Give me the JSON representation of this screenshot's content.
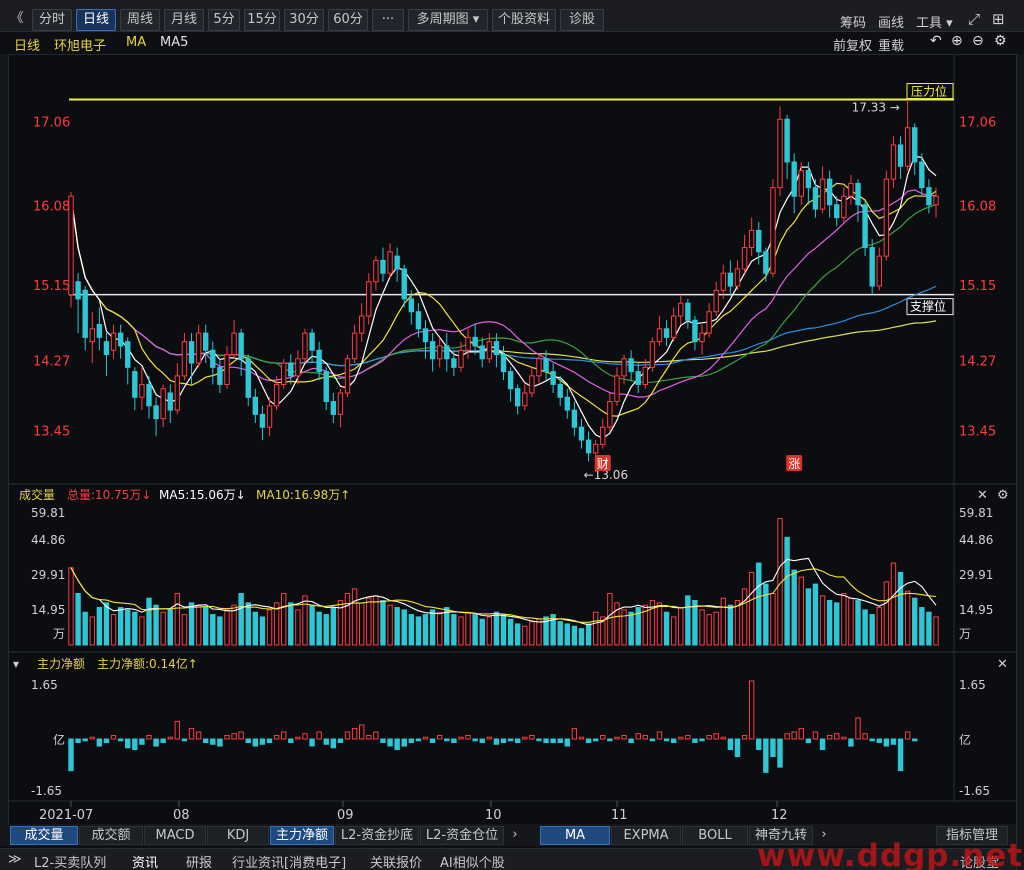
{
  "toolbar": {
    "items": [
      "《",
      "分时",
      "日线",
      "周线",
      "月线",
      "5分",
      "15分",
      "30分",
      "60分",
      "···",
      "多周期图 ▾",
      "个股资料",
      "诊股"
    ],
    "active": "日线",
    "right_items": [
      "筹码",
      "画线",
      "工具 ▾"
    ]
  },
  "sub_toolbar": {
    "period": "日线",
    "stock": "环旭电子",
    "ma_label": "MA",
    "ma_extra": "MA5",
    "right_items": [
      "前复权",
      "重载"
    ]
  },
  "price_panel": {
    "y_ticks": [
      "17.06",
      "16.08",
      "15.15",
      "14.27",
      "13.45"
    ],
    "high_marker": "17.33",
    "low_marker": "←13.06",
    "pressure_label": "压力位",
    "support_label": "支撑位",
    "events": [
      "财",
      "涨"
    ]
  },
  "volume_panel": {
    "title": "成交量",
    "total": "总量:10.75万",
    "ma5": "MA5:15.06万",
    "ma10": "MA10:16.98万",
    "y_ticks": [
      "59.81",
      "44.86",
      "29.91",
      "14.95",
      "万"
    ]
  },
  "flow_panel": {
    "title": "主力净额",
    "value": "主力净额:0.14亿",
    "y_ticks": [
      "1.65",
      "亿",
      "-1.65"
    ]
  },
  "x_axis": [
    "2021-07",
    "08",
    "09",
    "10",
    "11",
    "12"
  ],
  "indicator_tabs": {
    "left": [
      "成交量",
      "成交额",
      "MACD",
      "KDJ",
      "主力净额",
      "L2-资金抄底",
      "L2-资金仓位"
    ],
    "active_left": [
      "成交量",
      "主力净额"
    ],
    "right": [
      "MA",
      "EXPMA",
      "BOLL",
      "神奇九转"
    ],
    "active_right": "MA",
    "manage": "指标管理"
  },
  "bottom_bar": {
    "items": [
      "L2-买卖队列",
      "资讯",
      "研报",
      "行业资讯[消费电子]",
      "关联报价",
      "AI相似个股"
    ],
    "active": "资讯",
    "watermark": "www.ddgp.net",
    "right_text": "论股堂"
  },
  "colors": {
    "up": "#ff3b3b",
    "down": "#2ec7d6",
    "ma5": "#ffffff",
    "ma10": "#f5e23a",
    "ma20": "#e65ee6",
    "ma30": "#3ca23c",
    "ma60": "#2f8fe0",
    "ma120": "#dede5a"
  },
  "chart_data": {
    "type": "candlestick",
    "title": "环旭电子 日线",
    "x_months": [
      "2021-07",
      "08",
      "09",
      "10",
      "11",
      "12"
    ],
    "price_ylim": [
      13.0,
      17.5
    ],
    "horizontal_lines": [
      {
        "label": "压力位",
        "value": 17.33
      },
      {
        "label": "支撑位",
        "value": 15.05
      }
    ],
    "high": 17.33,
    "low": 13.06,
    "candles": [
      [
        15.05,
        16.2,
        16.25,
        14.9
      ],
      [
        15.2,
        15.0,
        15.3,
        14.6
      ],
      [
        15.1,
        14.55,
        15.15,
        14.4
      ],
      [
        14.5,
        14.65,
        14.85,
        14.25
      ],
      [
        14.7,
        14.55,
        14.9,
        14.4
      ],
      [
        14.5,
        14.35,
        14.6,
        14.1
      ],
      [
        14.4,
        14.6,
        14.7,
        14.3
      ],
      [
        14.6,
        14.45,
        14.7,
        14.3
      ],
      [
        14.5,
        14.2,
        14.55,
        14.0
      ],
      [
        14.15,
        13.85,
        14.2,
        13.7
      ],
      [
        13.85,
        14.0,
        14.2,
        13.7
      ],
      [
        14.0,
        13.75,
        14.1,
        13.6
      ],
      [
        13.75,
        13.6,
        13.85,
        13.4
      ],
      [
        13.6,
        13.95,
        14.0,
        13.5
      ],
      [
        13.9,
        13.7,
        14.0,
        13.55
      ],
      [
        13.7,
        14.1,
        14.25,
        13.65
      ],
      [
        14.1,
        14.5,
        14.6,
        14.05
      ],
      [
        14.5,
        14.25,
        14.6,
        14.0
      ],
      [
        14.25,
        14.6,
        14.7,
        14.2
      ],
      [
        14.6,
        14.4,
        14.7,
        14.25
      ],
      [
        14.4,
        14.2,
        14.5,
        14.0
      ],
      [
        14.2,
        14.0,
        14.3,
        13.9
      ],
      [
        14.0,
        14.35,
        14.45,
        13.95
      ],
      [
        14.35,
        14.6,
        14.75,
        14.3
      ],
      [
        14.6,
        14.3,
        14.65,
        14.1
      ],
      [
        14.3,
        13.85,
        14.35,
        13.75
      ],
      [
        13.85,
        13.65,
        13.95,
        13.55
      ],
      [
        13.65,
        13.5,
        13.75,
        13.35
      ],
      [
        13.5,
        13.75,
        13.85,
        13.4
      ],
      [
        13.75,
        14.0,
        14.1,
        13.7
      ],
      [
        14.0,
        14.25,
        14.3,
        13.95
      ],
      [
        14.25,
        14.1,
        14.35,
        14.0
      ],
      [
        14.1,
        14.3,
        14.4,
        14.0
      ],
      [
        14.3,
        14.6,
        14.65,
        14.25
      ],
      [
        14.6,
        14.4,
        14.65,
        14.25
      ],
      [
        14.4,
        14.15,
        14.5,
        14.05
      ],
      [
        14.15,
        13.8,
        14.2,
        13.7
      ],
      [
        13.8,
        13.65,
        13.9,
        13.55
      ],
      [
        13.65,
        13.9,
        13.95,
        13.5
      ],
      [
        13.9,
        14.3,
        14.35,
        13.85
      ],
      [
        14.3,
        14.6,
        14.7,
        14.25
      ],
      [
        14.6,
        14.8,
        14.95,
        14.5
      ],
      [
        14.8,
        15.2,
        15.3,
        14.7
      ],
      [
        15.2,
        15.45,
        15.5,
        15.1
      ],
      [
        15.45,
        15.3,
        15.6,
        15.2
      ],
      [
        15.3,
        15.55,
        15.65,
        15.25
      ],
      [
        15.5,
        15.35,
        15.6,
        15.2
      ],
      [
        15.35,
        15.0,
        15.4,
        14.9
      ],
      [
        15.0,
        14.85,
        15.1,
        14.7
      ],
      [
        14.85,
        14.65,
        14.95,
        14.55
      ],
      [
        14.65,
        14.5,
        14.75,
        14.3
      ],
      [
        14.5,
        14.3,
        14.6,
        14.15
      ],
      [
        14.3,
        14.45,
        14.55,
        14.2
      ],
      [
        14.45,
        14.3,
        14.6,
        14.15
      ],
      [
        14.3,
        14.2,
        14.4,
        14.1
      ],
      [
        14.2,
        14.4,
        14.5,
        14.15
      ],
      [
        14.4,
        14.55,
        14.65,
        14.3
      ],
      [
        14.55,
        14.45,
        14.7,
        14.35
      ],
      [
        14.45,
        14.3,
        14.55,
        14.2
      ],
      [
        14.3,
        14.5,
        14.6,
        14.25
      ],
      [
        14.5,
        14.35,
        14.6,
        14.2
      ],
      [
        14.35,
        14.15,
        14.45,
        14.05
      ],
      [
        14.15,
        13.95,
        14.2,
        13.8
      ],
      [
        13.95,
        13.75,
        14.0,
        13.65
      ],
      [
        13.75,
        13.9,
        14.0,
        13.7
      ],
      [
        13.9,
        14.1,
        14.2,
        13.85
      ],
      [
        14.1,
        14.3,
        14.35,
        14.0
      ],
      [
        14.3,
        14.15,
        14.4,
        14.05
      ],
      [
        14.15,
        14.0,
        14.25,
        13.9
      ],
      [
        14.0,
        13.85,
        14.1,
        13.75
      ],
      [
        13.85,
        13.7,
        13.95,
        13.6
      ],
      [
        13.7,
        13.5,
        13.8,
        13.4
      ],
      [
        13.5,
        13.35,
        13.6,
        13.25
      ],
      [
        13.35,
        13.2,
        13.45,
        13.1
      ],
      [
        13.2,
        13.3,
        13.35,
        13.06
      ],
      [
        13.3,
        13.5,
        13.6,
        13.25
      ],
      [
        13.5,
        13.8,
        13.9,
        13.45
      ],
      [
        13.8,
        14.1,
        14.2,
        13.75
      ],
      [
        14.1,
        14.3,
        14.35,
        14.0
      ],
      [
        14.3,
        14.15,
        14.4,
        14.05
      ],
      [
        14.15,
        14.0,
        14.25,
        13.9
      ],
      [
        14.0,
        14.2,
        14.3,
        13.95
      ],
      [
        14.2,
        14.5,
        14.55,
        14.15
      ],
      [
        14.5,
        14.65,
        14.8,
        14.45
      ],
      [
        14.65,
        14.55,
        14.75,
        14.45
      ],
      [
        14.55,
        14.8,
        14.9,
        14.5
      ],
      [
        14.8,
        14.95,
        15.05,
        14.7
      ],
      [
        14.95,
        14.75,
        15.0,
        14.65
      ],
      [
        14.75,
        14.5,
        14.8,
        14.4
      ],
      [
        14.5,
        14.6,
        14.7,
        14.35
      ],
      [
        14.6,
        14.85,
        14.95,
        14.55
      ],
      [
        14.85,
        15.1,
        15.2,
        14.8
      ],
      [
        15.1,
        15.3,
        15.4,
        15.0
      ],
      [
        15.3,
        15.15,
        15.45,
        15.05
      ],
      [
        15.15,
        15.35,
        15.45,
        15.1
      ],
      [
        15.35,
        15.6,
        15.75,
        15.3
      ],
      [
        15.6,
        15.8,
        15.95,
        15.5
      ],
      [
        15.8,
        15.55,
        15.9,
        15.4
      ],
      [
        15.55,
        15.3,
        15.6,
        15.2
      ],
      [
        15.3,
        16.3,
        16.4,
        15.25
      ],
      [
        16.3,
        17.1,
        17.25,
        16.2
      ],
      [
        17.1,
        16.6,
        17.15,
        16.4
      ],
      [
        16.6,
        16.2,
        16.7,
        16.0
      ],
      [
        16.2,
        16.5,
        16.6,
        16.1
      ],
      [
        16.5,
        16.3,
        16.6,
        16.1
      ],
      [
        16.3,
        16.05,
        16.4,
        15.95
      ],
      [
        16.05,
        16.4,
        16.55,
        16.0
      ],
      [
        16.4,
        16.1,
        16.5,
        15.95
      ],
      [
        16.1,
        15.95,
        16.2,
        15.85
      ],
      [
        15.95,
        16.2,
        16.3,
        15.9
      ],
      [
        16.2,
        16.35,
        16.45,
        16.1
      ],
      [
        16.35,
        16.1,
        16.4,
        15.9
      ],
      [
        16.1,
        15.6,
        16.15,
        15.5
      ],
      [
        15.6,
        15.15,
        15.7,
        15.05
      ],
      [
        15.15,
        15.5,
        15.6,
        15.1
      ],
      [
        15.5,
        16.4,
        16.5,
        15.45
      ],
      [
        16.4,
        16.8,
        16.9,
        16.3
      ],
      [
        16.8,
        16.55,
        16.9,
        16.4
      ],
      [
        16.55,
        17.0,
        17.33,
        16.5
      ],
      [
        17.0,
        16.6,
        17.05,
        16.45
      ],
      [
        16.6,
        16.3,
        16.7,
        16.2
      ],
      [
        16.3,
        16.1,
        16.4,
        16.0
      ],
      [
        16.1,
        16.2,
        16.3,
        15.95
      ]
    ],
    "volume_ylim": [
      0,
      59.81
    ],
    "volumes": [
      33,
      22,
      14,
      12,
      16,
      18,
      13,
      16,
      15,
      14,
      12,
      20,
      17,
      14,
      15,
      22,
      13,
      18,
      17,
      16,
      13,
      12,
      15,
      17,
      22,
      18,
      14,
      12,
      15,
      18,
      22,
      18,
      15,
      21,
      17,
      14,
      13,
      16,
      19,
      22,
      24,
      18,
      20,
      21,
      19,
      17,
      16,
      15,
      13,
      12,
      13,
      15,
      14,
      16,
      13,
      12,
      14,
      13,
      11,
      12,
      14,
      13,
      11,
      9,
      8,
      10,
      11,
      12,
      13,
      10,
      9,
      8,
      7,
      9,
      14,
      12,
      22,
      18,
      15,
      14,
      16,
      17,
      19,
      18,
      14,
      12,
      16,
      21,
      19,
      15,
      13,
      14,
      20,
      17,
      19,
      24,
      31,
      35,
      26,
      22,
      54,
      46,
      32,
      29,
      24,
      26,
      21,
      19,
      18,
      22,
      20,
      19,
      15,
      13,
      16,
      27,
      35,
      31,
      23,
      20,
      16,
      14,
      12
    ],
    "flow_ylim": [
      -1.65,
      1.65
    ],
    "flows": [
      -0.9,
      -0.1,
      -0.05,
      0.05,
      -0.2,
      -0.1,
      0.1,
      -0.05,
      -0.25,
      -0.3,
      -0.15,
      0.1,
      -0.2,
      -0.1,
      0.05,
      0.5,
      -0.05,
      0.3,
      0.2,
      -0.1,
      -0.15,
      -0.2,
      0.1,
      0.15,
      0.2,
      -0.1,
      -0.2,
      -0.15,
      -0.1,
      0.1,
      0.2,
      -0.1,
      0.05,
      0.15,
      -0.2,
      0.2,
      -0.15,
      -0.25,
      -0.1,
      0.2,
      0.3,
      0.4,
      0.1,
      0.2,
      -0.1,
      -0.2,
      -0.3,
      -0.2,
      -0.1,
      -0.05,
      0.05,
      -0.1,
      0.1,
      -0.05,
      -0.1,
      0.05,
      0.1,
      -0.05,
      -0.1,
      0.05,
      -0.15,
      -0.1,
      -0.05,
      -0.1,
      0.05,
      0.1,
      -0.05,
      -0.1,
      -0.1,
      -0.1,
      -0.2,
      0.3,
      0.05,
      -0.1,
      -0.05,
      0.1,
      -0.05,
      0.05,
      0.1,
      -0.1,
      0.15,
      0.1,
      -0.05,
      0.2,
      -0.05,
      -0.1,
      0.05,
      0.1,
      -0.1,
      -0.05,
      0.1,
      0.15,
      0.05,
      -0.3,
      -0.5,
      0.1,
      1.65,
      -0.3,
      -0.95,
      -0.5,
      -0.8,
      0.15,
      0.2,
      0.3,
      -0.1,
      0.2,
      -0.3,
      0.1,
      0.15,
      0.05,
      -0.2,
      0.6,
      0.15,
      -0.05,
      -0.1,
      -0.2,
      -0.15,
      -0.9,
      0.2,
      -0.05
    ]
  }
}
